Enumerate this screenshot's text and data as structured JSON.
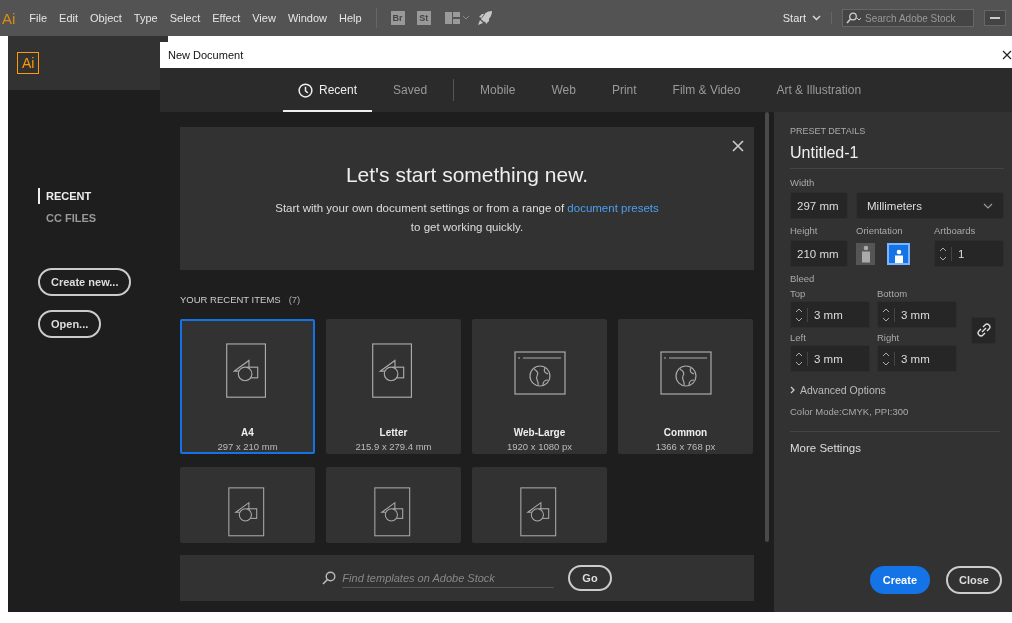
{
  "menu_bar": {
    "logo": "Ai",
    "menus": [
      "File",
      "Edit",
      "Object",
      "Type",
      "Select",
      "Effect",
      "View",
      "Window",
      "Help"
    ],
    "bridge_button": "Br",
    "stock_button": "St",
    "workspace": "Start",
    "search": {
      "placeholder": "Search Adobe Stock"
    }
  },
  "home": {
    "logo": "Ai",
    "sidebar": {
      "items": [
        {
          "label": "RECENT",
          "selected": true
        },
        {
          "label": "CC FILES",
          "selected": false
        }
      ]
    },
    "buttons": [
      "Create new...",
      "Open..."
    ]
  },
  "dialog": {
    "title": "New Document",
    "tabs": [
      {
        "label": "Recent",
        "selected": true,
        "kind": "clock"
      },
      {
        "label": "Saved",
        "selected": false
      },
      {
        "label": "Mobile",
        "selected": false,
        "kind": "divided"
      },
      {
        "label": "Web",
        "selected": false
      },
      {
        "label": "Print",
        "selected": false
      },
      {
        "label": "Film & Video",
        "selected": false
      },
      {
        "label": "Art & Illustration",
        "selected": false
      }
    ],
    "banner": {
      "title": "Let's start something new.",
      "text_before": "Start with your own document settings or from a range of",
      "link": "document presets",
      "text_after": "to get working quickly."
    },
    "recent": {
      "heading": "YOUR RECENT ITEMS",
      "count": "(7)",
      "items": [
        {
          "kind": "print",
          "name": "A4",
          "size": "297 x 210 mm",
          "selected": true
        },
        {
          "kind": "print",
          "name": "Letter",
          "size": "215.9 x 279.4 mm",
          "selected": false
        },
        {
          "kind": "web",
          "name": "Web-Large",
          "size": "1920 x 1080 px",
          "selected": false
        },
        {
          "kind": "web",
          "name": "Common",
          "size": "1366 x 768 px",
          "selected": false
        },
        {
          "kind": "print",
          "selected": false
        },
        {
          "kind": "print",
          "selected": false
        },
        {
          "kind": "print",
          "selected": false
        }
      ]
    },
    "template_search": {
      "placeholder": "Find templates on Adobe Stock",
      "button": "Go"
    },
    "preset": {
      "heading": "PRESET DETAILS",
      "name": "Untitled-1",
      "width_label": "Width",
      "width": "297 mm",
      "units": "Millimeters",
      "height_label": "Height",
      "height": "210 mm",
      "orientation_label": "Orientation",
      "orientations": [
        {
          "kind": "portrait",
          "selected": false
        },
        {
          "kind": "landscape",
          "selected": true
        }
      ],
      "artboards_label": "Artboards",
      "artboards": "1",
      "bleed_label": "Bleed",
      "bleed": [
        {
          "label": "Top",
          "value": "3 mm"
        },
        {
          "label": "Bottom",
          "value": "3 mm"
        },
        {
          "label": "Left",
          "value": "3 mm"
        },
        {
          "label": "Right",
          "value": "3 mm"
        }
      ],
      "advanced": "Advanced Options",
      "color_mode": "Color Mode:CMYK, PPI:300",
      "more_settings": "More Settings"
    },
    "buttons": {
      "primary": "Create",
      "secondary": "Close"
    }
  }
}
